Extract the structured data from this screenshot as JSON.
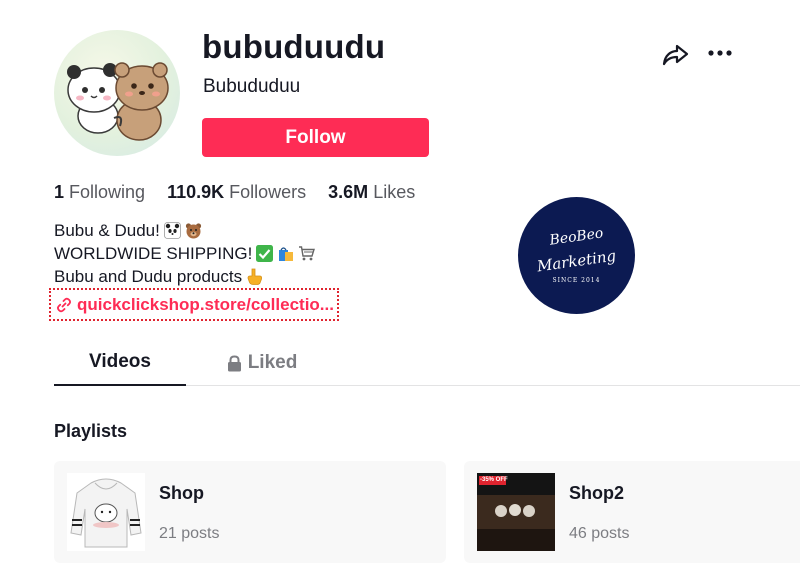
{
  "profile": {
    "username": "bubuduudu",
    "nickname": "Bubududuu",
    "follow_label": "Follow"
  },
  "stats": [
    {
      "value": "1",
      "label": "Following"
    },
    {
      "value": "110.9K",
      "label": "Followers"
    },
    {
      "value": "3.6M",
      "label": "Likes"
    }
  ],
  "bio": {
    "lines": [
      {
        "text": "Bubu & Dudu!",
        "icons": [
          "panda-emoji-icon",
          "bear-emoji-icon"
        ]
      },
      {
        "text": "WORLDWIDE SHIPPING!",
        "icons": [
          "check-mark-emoji-icon",
          "shopping-bags-emoji-icon",
          "shopping-cart-emoji-icon"
        ]
      },
      {
        "text": "Bubu and Dudu products",
        "icons": [
          "pointing-down-emoji-icon"
        ]
      }
    ],
    "link": "quickclickshop.store/collectio..."
  },
  "watermark": {
    "line1": "BeoBeo",
    "line2": "Marketing",
    "line3": "SINCE 2014"
  },
  "tabs": [
    {
      "label": "Videos",
      "active": true
    },
    {
      "label": "Liked",
      "active": false,
      "icon": "lock-icon"
    }
  ],
  "playlists_title": "Playlists",
  "playlists": [
    {
      "name": "Shop",
      "count": "21 posts"
    },
    {
      "name": "Shop2",
      "count": "46 posts",
      "thumb_badge": "-35% OFF"
    }
  ],
  "colors": {
    "accent": "#fe2c55",
    "text": "#161823",
    "muted": "#7c7d82",
    "watermark_bg": "#0c1a52"
  }
}
